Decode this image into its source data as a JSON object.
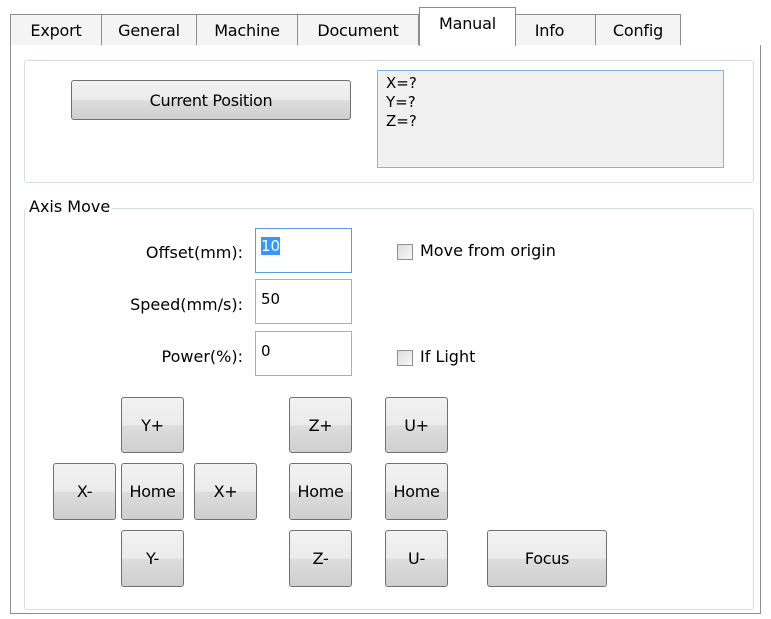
{
  "tabs": [
    "Export",
    "General",
    "Machine",
    "Document",
    "Manual",
    "Info",
    "Config"
  ],
  "active_tab": "Manual",
  "current_position": {
    "button_label": "Current Position",
    "x": "X=?",
    "y": "Y=?",
    "z": "Z=?"
  },
  "axis_move": {
    "title": "Axis Move",
    "offset_label": "Offset(mm):",
    "offset_value": "10",
    "speed_label": "Speed(mm/s):",
    "speed_value": "50",
    "power_label": "Power(%):",
    "power_value": "0",
    "move_from_origin_label": "Move from origin",
    "move_from_origin_checked": false,
    "if_light_label": "If Light",
    "if_light_checked": false
  },
  "buttons": {
    "y_plus": "Y+",
    "y_minus": "Y-",
    "x_minus": "X-",
    "x_plus": "X+",
    "xy_home": "Home",
    "z_plus": "Z+",
    "z_home": "Home",
    "z_minus": "Z-",
    "u_plus": "U+",
    "u_home": "Home",
    "u_minus": "U-",
    "focus": "Focus"
  }
}
